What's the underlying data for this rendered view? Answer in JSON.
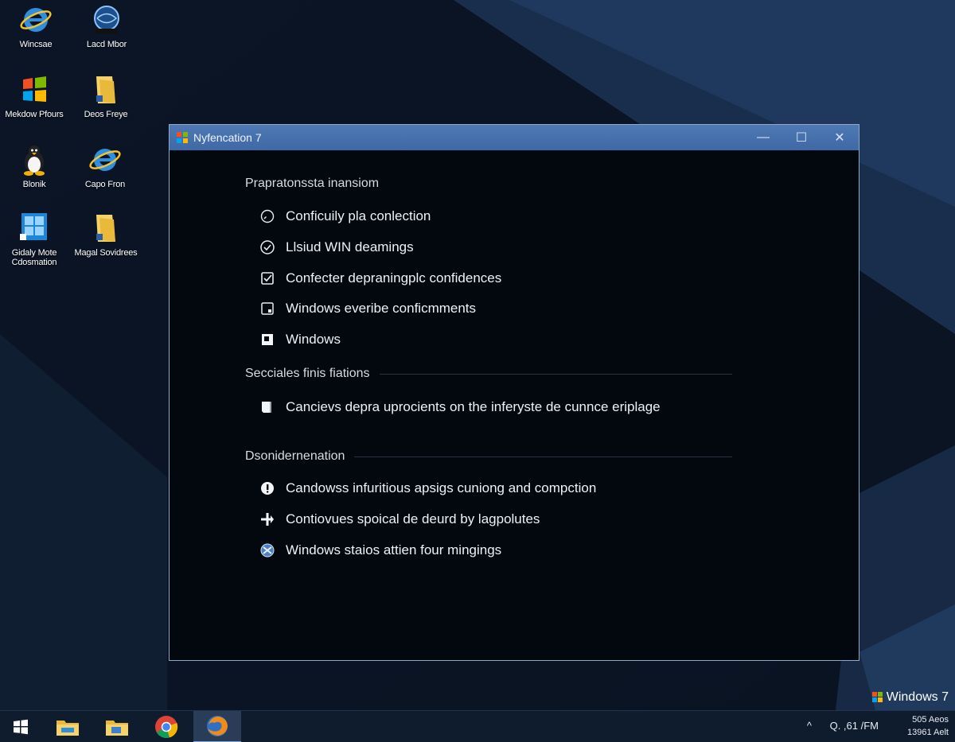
{
  "desktop_icons": [
    {
      "label": "Wincsae",
      "icon": "internet-explorer-icon"
    },
    {
      "label": "Lacd Mbor",
      "icon": "network-globe-icon"
    },
    {
      "label": "Mekdow Pfours",
      "icon": "windows-flag-icon"
    },
    {
      "label": "Deos Freye",
      "icon": "folder-icon"
    },
    {
      "label": "Blonik",
      "icon": "penguin-icon"
    },
    {
      "label": "Capo Fron",
      "icon": "internet-explorer-icon"
    },
    {
      "label": "Gidaly Mote Cdosmation",
      "icon": "windows-logo-icon"
    },
    {
      "label": "Magal Sovidrees",
      "icon": "folder-icon"
    }
  ],
  "window": {
    "title": "Nyfencation 7",
    "controls": {
      "minimize": "—",
      "maximize": "☐",
      "close": "✕"
    }
  },
  "sections": {
    "s1_heading": "Prapratonssta inansiom",
    "s1_items": [
      {
        "text": "Conficuily pla conlection",
        "icon": "search-circle-icon"
      },
      {
        "text": "Llsiud WIN deamings",
        "icon": "check-circle-icon"
      },
      {
        "text": "Confecter depraningplc confidences",
        "icon": "checkbox-checked-icon"
      },
      {
        "text": "Windows everibe conficmments",
        "icon": "checkbox-empty-icon"
      },
      {
        "text": "Windows",
        "icon": "checkbox-filled-icon"
      }
    ],
    "s2_heading": "Secciales finis fiations",
    "s2_items": [
      {
        "text": "Cancievs depra uprocients on the inferyste de cunnce eriplage",
        "icon": "document-icon"
      }
    ],
    "s3_heading": "Dsonidernenation",
    "s3_items": [
      {
        "text": "Candowss infuritious apsigs cuniong and compction",
        "icon": "info-circle-icon"
      },
      {
        "text": "Contiovues spoical de deurd by lagpolutes",
        "icon": "plus-arrow-icon"
      },
      {
        "text": "Windows staios attien four mingings",
        "icon": "windows-sphere-icon"
      }
    ]
  },
  "taskbar": {
    "apps": [
      {
        "name": "start-button",
        "icon": "windows-start-icon"
      },
      {
        "name": "file-explorer",
        "icon": "folder-icon"
      },
      {
        "name": "file-explorer-2",
        "icon": "folder-icon"
      },
      {
        "name": "chrome",
        "icon": "chrome-icon"
      },
      {
        "name": "firefox",
        "icon": "firefox-icon"
      }
    ],
    "tray_chevron": "^",
    "tray_label": "Q. ,61 /FM",
    "clock_line1": "505 Aeos",
    "clock_line2": "13961 Aelt"
  },
  "brand": "Windows 7",
  "colors": {
    "titlebar": "#4a74b0",
    "window_bg": "#03070e",
    "taskbar": "#0f1c2e",
    "accent": "#7fa6d8"
  }
}
